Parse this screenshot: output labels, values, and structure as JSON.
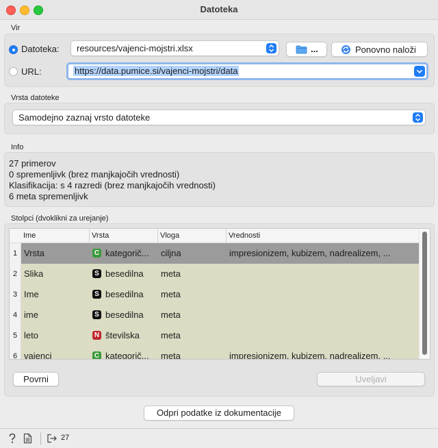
{
  "window": {
    "title": "Datoteka"
  },
  "source": {
    "label": "Vir",
    "file_radio_label": "Datoteka:",
    "file_value": "resources/vajenci-mojstri.xlsx",
    "browse_label": "...",
    "reload_label": "Ponovno naloži",
    "url_radio_label": "URL:",
    "url_value": "https://data.pumice.si/vajenci-mojstri/data",
    "selected": "file"
  },
  "file_type": {
    "label": "Vrsta datoteke",
    "value": "Samodejno zaznaj vrsto datoteke"
  },
  "info": {
    "label": "Info",
    "lines": [
      "27 primerov",
      "0 spremenljivk (brez manjkajočih vrednosti)",
      "Klasifikacija: s 4 razredi (brez manjkajočih vrednosti)",
      "6 meta spremenljivk"
    ]
  },
  "columns": {
    "label": "Stolpci (dvoklikni za urejanje)",
    "headers": [
      "Ime",
      "Vrsta",
      "Vloga",
      "Vrednosti"
    ],
    "rows": [
      {
        "num": "1",
        "name": "Vrsta",
        "badge": "C",
        "type": "kategorič...",
        "role": "ciljna",
        "values": "impresionizem, kubizem, nadrealizem, ..."
      },
      {
        "num": "2",
        "name": "Slika",
        "badge": "S",
        "type": "besedilna",
        "role": "meta",
        "values": ""
      },
      {
        "num": "3",
        "name": "Ime",
        "badge": "S",
        "type": "besedilna",
        "role": "meta",
        "values": ""
      },
      {
        "num": "4",
        "name": "ime",
        "badge": "S",
        "type": "besedilna",
        "role": "meta",
        "values": ""
      },
      {
        "num": "5",
        "name": "leto",
        "badge": "N",
        "type": "številska",
        "role": "meta",
        "values": ""
      },
      {
        "num": "6",
        "name": "vajenci",
        "badge": "C",
        "type": "kategorič...",
        "role": "meta",
        "values": "impresionizem, kubizem, nadrealizem, ..."
      }
    ],
    "reset_label": "Povrni",
    "apply_label": "Uveljavi"
  },
  "doc_button_label": "Odpri podatke iz dokumentacije",
  "status": {
    "output_count": "27"
  },
  "colors": {
    "accent": "#1f7cf5",
    "row_selected": "#9b9b9b",
    "row_meta": "#dcdcc4",
    "badge_C": "#3a9a3a",
    "badge_S": "#111111",
    "badge_N": "#c0272d"
  }
}
